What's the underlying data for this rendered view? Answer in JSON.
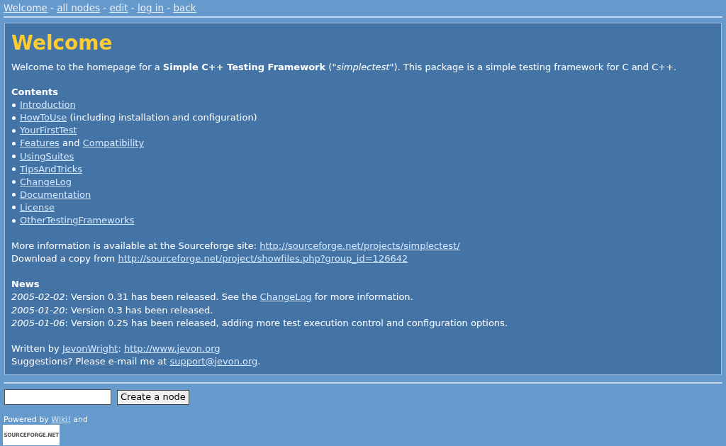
{
  "nav": [
    {
      "kind": "link",
      "text": "Welcome"
    },
    {
      "kind": "text",
      "text": " - "
    },
    {
      "kind": "link",
      "text": "all nodes"
    },
    {
      "kind": "text",
      "text": " - "
    },
    {
      "kind": "link",
      "text": "edit"
    },
    {
      "kind": "text",
      "text": " - "
    },
    {
      "kind": "link",
      "text": "log in"
    },
    {
      "kind": "text",
      "text": " - "
    },
    {
      "kind": "link",
      "text": "back"
    }
  ],
  "page_title": "Welcome",
  "intro": [
    {
      "kind": "text",
      "text": "Welcome to the homepage for a "
    },
    {
      "kind": "bold",
      "text": "Simple C++ Testing Framework"
    },
    {
      "kind": "text",
      "text": " (\""
    },
    {
      "kind": "italic",
      "text": "simplectest"
    },
    {
      "kind": "text",
      "text": "\"). This package is a simple testing framework for C and C++."
    }
  ],
  "contents": {
    "heading": "Contents",
    "items": [
      [
        {
          "kind": "link",
          "text": "Introduction"
        }
      ],
      [
        {
          "kind": "link",
          "text": "HowToUse"
        },
        {
          "kind": "text",
          "text": " (including installation and configuration)"
        }
      ],
      [
        {
          "kind": "link",
          "text": "YourFirstTest"
        }
      ],
      [
        {
          "kind": "link",
          "text": "Features"
        },
        {
          "kind": "text",
          "text": " and "
        },
        {
          "kind": "link",
          "text": "Compatibility"
        }
      ],
      [
        {
          "kind": "link",
          "text": "UsingSuites"
        }
      ],
      [
        {
          "kind": "link",
          "text": "TipsAndTricks"
        }
      ],
      [
        {
          "kind": "link",
          "text": "ChangeLog"
        }
      ],
      [
        {
          "kind": "link",
          "text": "Documentation"
        }
      ],
      [
        {
          "kind": "link",
          "text": "License"
        }
      ],
      [
        {
          "kind": "link",
          "text": "OtherTestingFrameworks"
        }
      ]
    ]
  },
  "more_info": [
    [
      {
        "kind": "text",
        "text": "More information is available at the Sourceforge site: "
      },
      {
        "kind": "link",
        "text": "http://sourceforge.net/projects/simplectest/"
      }
    ],
    [
      {
        "kind": "text",
        "text": "Download a copy from "
      },
      {
        "kind": "link",
        "text": "http://sourceforge.net/project/showfiles.php?group_id=126642"
      }
    ]
  ],
  "news": {
    "heading": "News",
    "items": [
      [
        {
          "kind": "italic",
          "text": "2005-02-02"
        },
        {
          "kind": "text",
          "text": ": Version 0.31 has been released. See the "
        },
        {
          "kind": "link",
          "text": "ChangeLog"
        },
        {
          "kind": "text",
          "text": " for more information."
        }
      ],
      [
        {
          "kind": "italic",
          "text": "2005-01-20"
        },
        {
          "kind": "text",
          "text": ": Version 0.3 has been released."
        }
      ],
      [
        {
          "kind": "italic",
          "text": "2005-01-06"
        },
        {
          "kind": "text",
          "text": ": Version 0.25 has been released, adding more test execution control and configuration options."
        }
      ]
    ]
  },
  "author": [
    [
      {
        "kind": "text",
        "text": "Written by "
      },
      {
        "kind": "link",
        "text": "JevonWright"
      },
      {
        "kind": "text",
        "text": ": "
      },
      {
        "kind": "link",
        "text": "http://www.jevon.org"
      }
    ],
    [
      {
        "kind": "text",
        "text": "Suggestions? Please e-mail me at "
      },
      {
        "kind": "link",
        "text": "support@jevon.org"
      },
      {
        "kind": "text",
        "text": "."
      }
    ]
  ],
  "create_form": {
    "button": "Create a node"
  },
  "powered_by": [
    {
      "kind": "text",
      "text": "Powered by "
    },
    {
      "kind": "link",
      "text": "Wiki!"
    },
    {
      "kind": "text",
      "text": " and"
    }
  ],
  "badge": "SOURCEFORGE.NET"
}
